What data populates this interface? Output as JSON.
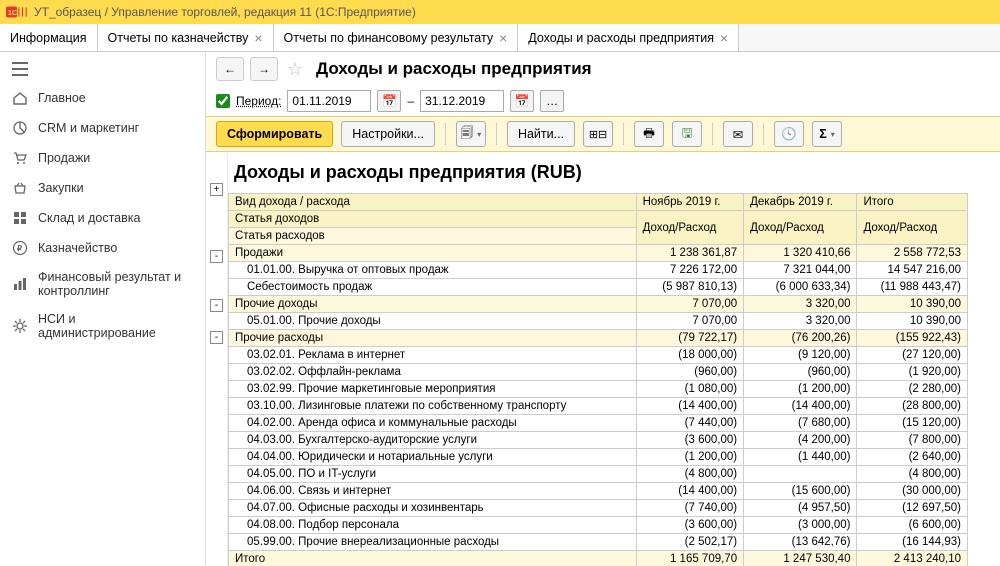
{
  "titlebar": "УТ_образец / Управление торговлей, редакция 11  (1С:Предприятие)",
  "tabs": [
    {
      "label": "Информация",
      "closable": false
    },
    {
      "label": "Отчеты по казначейству",
      "closable": true
    },
    {
      "label": "Отчеты по финансовому результату",
      "closable": true
    },
    {
      "label": "Доходы и расходы предприятия",
      "closable": true
    }
  ],
  "sidebar": [
    {
      "icon": "home",
      "label": "Главное"
    },
    {
      "icon": "pie",
      "label": "CRM и маркетинг"
    },
    {
      "icon": "cart",
      "label": "Продажи"
    },
    {
      "icon": "basket",
      "label": "Закупки"
    },
    {
      "icon": "boxes",
      "label": "Склад и доставка"
    },
    {
      "icon": "ruble",
      "label": "Казначейство"
    },
    {
      "icon": "bars",
      "label": "Финансовый результат и контроллинг"
    },
    {
      "icon": "gear",
      "label": "НСИ и администрирование"
    }
  ],
  "header": {
    "title": "Доходы и расходы предприятия",
    "period_label": "Период:",
    "date_from": "01.11.2019",
    "date_to": "31.12.2019",
    "dash": "–"
  },
  "toolbar": {
    "generate": "Сформировать",
    "settings": "Настройки...",
    "find": "Найти..."
  },
  "report": {
    "title": "Доходы и расходы предприятия (RUB)",
    "columns": {
      "name": "Вид дохода / расхода",
      "sub1": "Статья доходов",
      "sub2": "Статья расходов",
      "nov": "Ноябрь 2019 г.",
      "dec": "Декабрь 2019 г.",
      "total": "Итого",
      "metric": "Доход/Расход"
    },
    "rows": [
      {
        "lvl": 0,
        "toggle": "-",
        "name": "Продажи",
        "nov": "1 238 361,87",
        "dec": "1 320 410,66",
        "tot": "2 558 772,53"
      },
      {
        "lvl": 1,
        "name": "01.01.00. Выручка от оптовых продаж",
        "nov": "7 226 172,00",
        "dec": "7 321 044,00",
        "tot": "14 547 216,00"
      },
      {
        "lvl": 1,
        "name": "Себестоимость продаж",
        "nov": "(5 987 810,13)",
        "dec": "(6 000 633,34)",
        "tot": "(11 988 443,47)"
      },
      {
        "lvl": 0,
        "toggle": "-",
        "name": "Прочие доходы",
        "nov": "7 070,00",
        "dec": "3 320,00",
        "tot": "10 390,00"
      },
      {
        "lvl": 1,
        "name": "05.01.00. Прочие доходы",
        "nov": "7 070,00",
        "dec": "3 320,00",
        "tot": "10 390,00"
      },
      {
        "lvl": 0,
        "toggle": "-",
        "name": "Прочие расходы",
        "nov": "(79 722,17)",
        "dec": "(76 200,26)",
        "tot": "(155 922,43)"
      },
      {
        "lvl": 1,
        "name": "03.02.01. Реклама в интернет",
        "nov": "(18 000,00)",
        "dec": "(9 120,00)",
        "tot": "(27 120,00)"
      },
      {
        "lvl": 1,
        "name": "03.02.02. Оффлайн-реклама",
        "nov": "(960,00)",
        "dec": "(960,00)",
        "tot": "(1 920,00)"
      },
      {
        "lvl": 1,
        "name": "03.02.99. Прочие маркетинговые мероприятия",
        "nov": "(1 080,00)",
        "dec": "(1 200,00)",
        "tot": "(2 280,00)"
      },
      {
        "lvl": 1,
        "name": "03.10.00. Лизинговые платежи по собственному транспорту",
        "nov": "(14 400,00)",
        "dec": "(14 400,00)",
        "tot": "(28 800,00)"
      },
      {
        "lvl": 1,
        "name": "04.02.00. Аренда офиса и коммунальные расходы",
        "nov": "(7 440,00)",
        "dec": "(7 680,00)",
        "tot": "(15 120,00)"
      },
      {
        "lvl": 1,
        "name": "04.03.00. Бухгалтерско-аудиторские услуги",
        "nov": "(3 600,00)",
        "dec": "(4 200,00)",
        "tot": "(7 800,00)"
      },
      {
        "lvl": 1,
        "name": "04.04.00. Юридически и нотариальные услуги",
        "nov": "(1 200,00)",
        "dec": "(1 440,00)",
        "tot": "(2 640,00)"
      },
      {
        "lvl": 1,
        "name": "04.05.00. ПО и IT-услуги",
        "nov": "(4 800,00)",
        "dec": "",
        "tot": "(4 800,00)"
      },
      {
        "lvl": 1,
        "name": "04.06.00. Связь и интернет",
        "nov": "(14 400,00)",
        "dec": "(15 600,00)",
        "tot": "(30 000,00)"
      },
      {
        "lvl": 1,
        "name": "04.07.00. Офисные расходы и хозинвентарь",
        "nov": "(7 740,00)",
        "dec": "(4 957,50)",
        "tot": "(12 697,50)"
      },
      {
        "lvl": 1,
        "name": "04.08.00. Подбор персонала",
        "nov": "(3 600,00)",
        "dec": "(3 000,00)",
        "tot": "(6 600,00)"
      },
      {
        "lvl": 1,
        "name": "05.99.00. Прочие внереализационные расходы",
        "nov": "(2 502,17)",
        "dec": "(13 642,76)",
        "tot": "(16 144,93)"
      }
    ],
    "total_row": {
      "name": "Итого",
      "nov": "1 165 709,70",
      "dec": "1 247 530,40",
      "tot": "2 413 240,10"
    }
  },
  "tree_toggles": [
    "+",
    "-",
    "-",
    "-"
  ]
}
